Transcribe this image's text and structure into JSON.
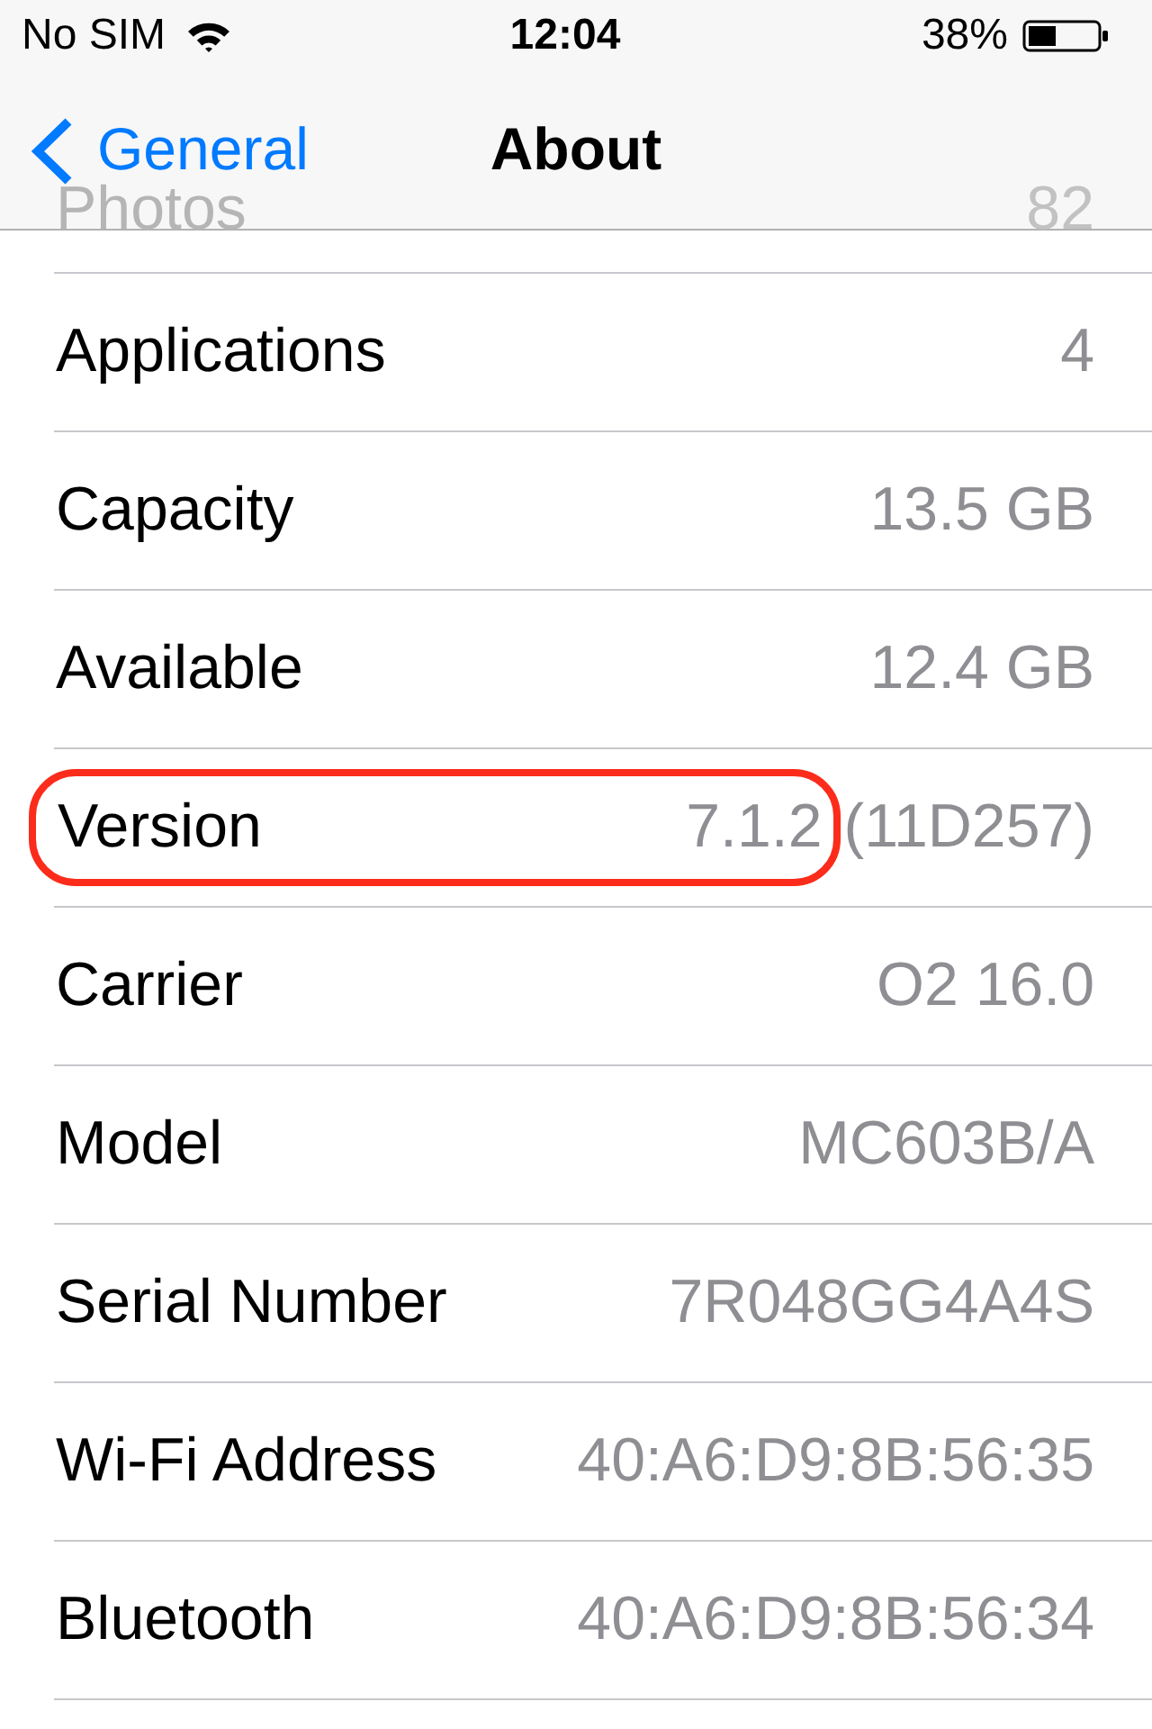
{
  "status_bar": {
    "carrier": "No SIM",
    "time": "12:04",
    "battery": "38%"
  },
  "nav_bar": {
    "back_label": "General",
    "title": "About"
  },
  "row_under_bar": {
    "label": "Photos",
    "value": "82"
  },
  "rows": [
    {
      "label": "Applications",
      "value": "4",
      "highlighted": false
    },
    {
      "label": "Capacity",
      "value": "13.5 GB",
      "highlighted": false
    },
    {
      "label": "Available",
      "value": "12.4 GB",
      "highlighted": false
    },
    {
      "label": "Version",
      "value": "7.1.2",
      "build": "(11D257)",
      "highlighted": true
    },
    {
      "label": "Carrier",
      "value": "O2 16.0",
      "highlighted": false
    },
    {
      "label": "Model",
      "value": "MC603B/A",
      "highlighted": false
    },
    {
      "label": "Serial Number",
      "value": "7R048GG4A4S",
      "highlighted": false
    },
    {
      "label": "Wi-Fi Address",
      "value": "40:A6:D9:8B:56:35",
      "highlighted": false
    },
    {
      "label": "Bluetooth",
      "value": "40:A6:D9:8B:56:34",
      "highlighted": false
    }
  ]
}
